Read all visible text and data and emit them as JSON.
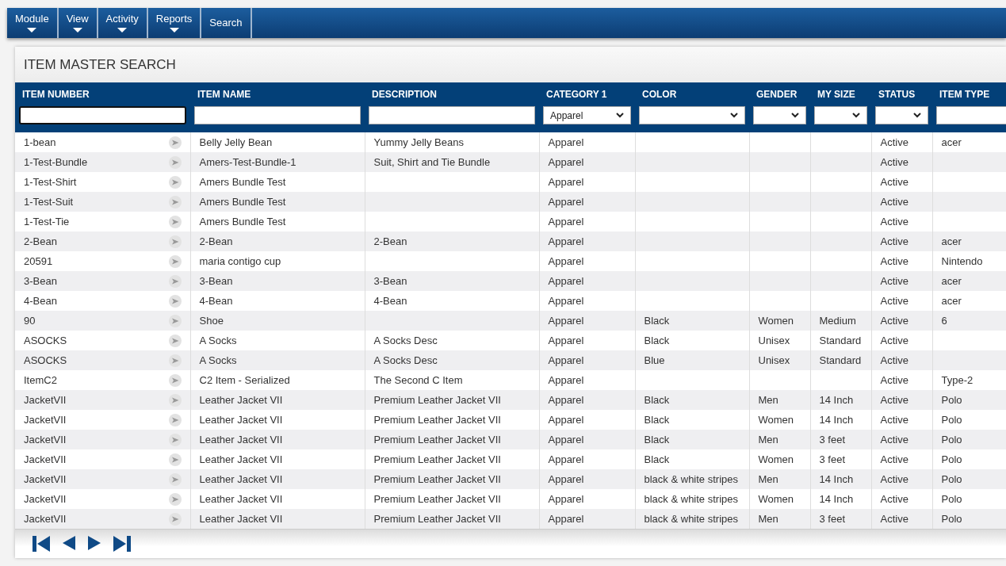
{
  "menu": [
    {
      "label": "Module",
      "dropdown": true
    },
    {
      "label": "View",
      "dropdown": true
    },
    {
      "label": "Activity",
      "dropdown": true
    },
    {
      "label": "Reports",
      "dropdown": true
    },
    {
      "label": "Search",
      "dropdown": false
    }
  ],
  "panel": {
    "title": "ITEM MASTER SEARCH"
  },
  "table": {
    "columns": [
      {
        "label": "ITEM NUMBER",
        "filter": {
          "kind": "text",
          "focused": true
        }
      },
      {
        "label": "ITEM NAME",
        "filter": {
          "kind": "text",
          "focused": false
        }
      },
      {
        "label": "DESCRIPTION",
        "filter": {
          "kind": "text",
          "focused": false
        }
      },
      {
        "label": "CATEGORY 1",
        "filter": {
          "kind": "select",
          "value": "Apparel"
        }
      },
      {
        "label": "COLOR",
        "filter": {
          "kind": "select"
        }
      },
      {
        "label": "GENDER",
        "filter": {
          "kind": "select"
        }
      },
      {
        "label": "MY SIZE",
        "filter": {
          "kind": "select"
        }
      },
      {
        "label": "STATUS",
        "filter": {
          "kind": "select"
        }
      },
      {
        "label": "ITEM TYPE",
        "filter": {
          "kind": "text",
          "focused": false
        }
      }
    ],
    "rows": [
      {
        "cells": [
          "1-bean",
          "Belly Jelly Bean",
          "Yummy Jelly Beans",
          "Apparel",
          null,
          null,
          null,
          "Active",
          "acer"
        ]
      },
      {
        "cells": [
          "1-Test-Bundle",
          "Amers-Test-Bundle-1",
          "Suit, Shirt and Tie Bundle",
          "Apparel",
          null,
          null,
          null,
          "Active",
          null
        ]
      },
      {
        "cells": [
          "1-Test-Shirt",
          "Amers Bundle Test",
          null,
          "Apparel",
          null,
          null,
          null,
          "Active",
          null
        ]
      },
      {
        "cells": [
          "1-Test-Suit",
          "Amers Bundle Test",
          null,
          "Apparel",
          null,
          null,
          null,
          "Active",
          null
        ]
      },
      {
        "cells": [
          "1-Test-Tie",
          "Amers Bundle Test",
          null,
          "Apparel",
          null,
          null,
          null,
          "Active",
          null
        ]
      },
      {
        "cells": [
          "2-Bean",
          "2-Bean",
          "2-Bean",
          "Apparel",
          null,
          null,
          null,
          "Active",
          "acer"
        ]
      },
      {
        "cells": [
          "20591",
          "maria contigo cup",
          null,
          "Apparel",
          null,
          null,
          null,
          "Active",
          "Nintendo"
        ]
      },
      {
        "cells": [
          "3-Bean",
          "3-Bean",
          "3-Bean",
          "Apparel",
          null,
          null,
          null,
          "Active",
          "acer"
        ]
      },
      {
        "cells": [
          "4-Bean",
          "4-Bean",
          "4-Bean",
          "Apparel",
          null,
          null,
          null,
          "Active",
          "acer"
        ]
      },
      {
        "cells": [
          "90",
          "Shoe",
          null,
          "Apparel",
          "Black",
          "Women",
          "Medium",
          "Active",
          "6"
        ]
      },
      {
        "cells": [
          "ASOCKS",
          "A Socks",
          "A Socks Desc",
          "Apparel",
          "Black",
          "Unisex",
          "Standard",
          "Active",
          null
        ]
      },
      {
        "cells": [
          "ASOCKS",
          "A Socks",
          "A Socks Desc",
          "Apparel",
          "Blue",
          "Unisex",
          "Standard",
          "Active",
          null
        ]
      },
      {
        "cells": [
          "ItemC2",
          "C2 Item - Serialized",
          "The Second C Item",
          "Apparel",
          null,
          null,
          null,
          "Active",
          "Type-2"
        ]
      },
      {
        "cells": [
          "JacketVII",
          "Leather Jacket VII",
          "Premium Leather Jacket VII",
          "Apparel",
          "Black",
          "Men",
          "14 Inch",
          "Active",
          "Polo"
        ]
      },
      {
        "cells": [
          "JacketVII",
          "Leather Jacket VII",
          "Premium Leather Jacket VII",
          "Apparel",
          "Black",
          "Women",
          "14 Inch",
          "Active",
          "Polo"
        ]
      },
      {
        "cells": [
          "JacketVII",
          "Leather Jacket VII",
          "Premium Leather Jacket VII",
          "Apparel",
          "Black",
          "Men",
          "3 feet",
          "Active",
          "Polo"
        ]
      },
      {
        "cells": [
          "JacketVII",
          "Leather Jacket VII",
          "Premium Leather Jacket VII",
          "Apparel",
          "Black",
          "Women",
          "3 feet",
          "Active",
          "Polo"
        ]
      },
      {
        "cells": [
          "JacketVII",
          "Leather Jacket VII",
          "Premium Leather Jacket VII",
          "Apparel",
          "black & white stripes",
          "Men",
          "14 Inch",
          "Active",
          "Polo"
        ]
      },
      {
        "cells": [
          "JacketVII",
          "Leather Jacket VII",
          "Premium Leather Jacket VII",
          "Apparel",
          "black & white stripes",
          "Women",
          "14 Inch",
          "Active",
          "Polo"
        ]
      },
      {
        "cells": [
          "JacketVII",
          "Leather Jacket VII",
          "Premium Leather Jacket VII",
          "Apparel",
          "black & white stripes",
          "Men",
          "3 feet",
          "Active",
          "Polo"
        ]
      }
    ]
  }
}
